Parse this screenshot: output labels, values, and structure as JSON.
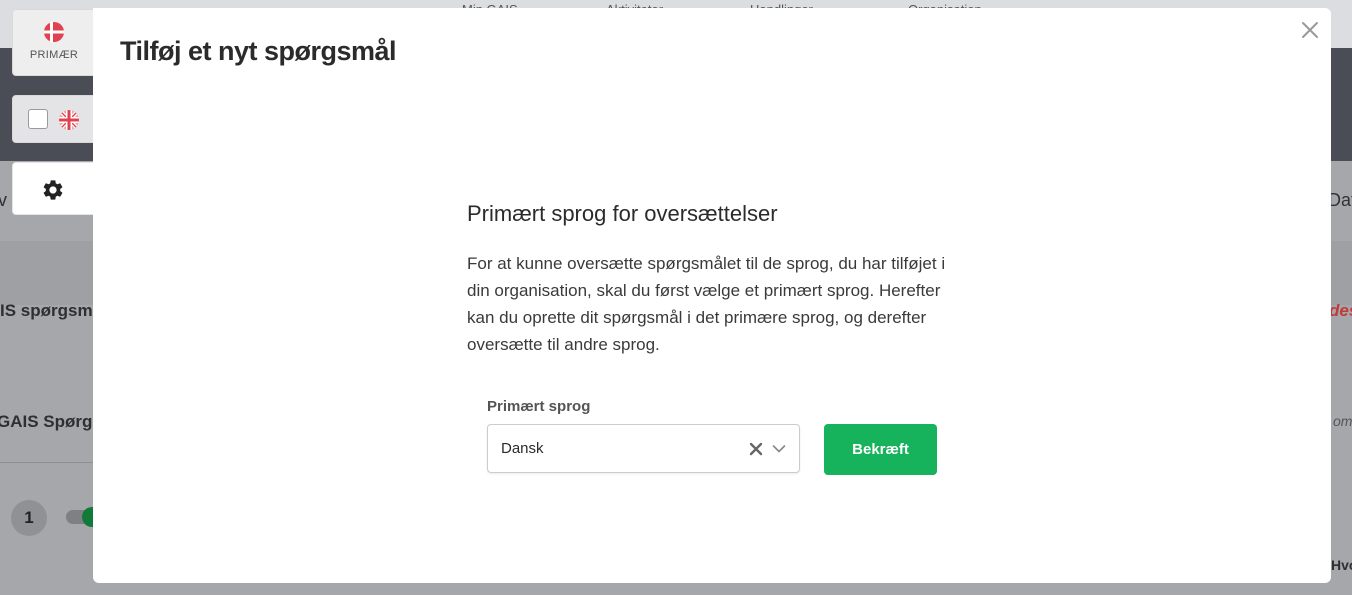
{
  "background": {
    "nav_items": [
      "Min GAIS",
      "Aktiviteter",
      "Handlinger",
      "Organisation"
    ],
    "left_text_1": "v",
    "left_text_2": "IS spørgsmå",
    "left_text_3": "GAIS Spørgs",
    "row_number": "1",
    "right_text_1": "Dat",
    "right_text_2": "des",
    "right_text_3": "oma",
    "right_text_4": "Hvo"
  },
  "language_tabs": {
    "primary_label": "PRIMÆR",
    "primary_flag": "flag-denmark-icon",
    "secondary_flag": "flag-united-kingdom-icon",
    "settings_icon": "gear-icon"
  },
  "modal": {
    "title": "Tilføj et nyt spørgsmål",
    "close_icon": "close-icon",
    "section_heading": "Primært sprog for oversættelser",
    "section_text": "For at kunne oversætte spørgsmålet til de sprog, du har tilføjet i din organisation, skal du først vælge et primært sprog. Herefter kan du oprette dit spørgsmål i det primære sprog, og derefter oversætte til andre sprog.",
    "field_label": "Primært sprog",
    "select_value": "Dansk",
    "confirm_label": "Bekræft"
  },
  "colors": {
    "confirm_button": "#16b25c",
    "flag_red": "#e0424e",
    "overlay_header": "#4a4d56"
  }
}
